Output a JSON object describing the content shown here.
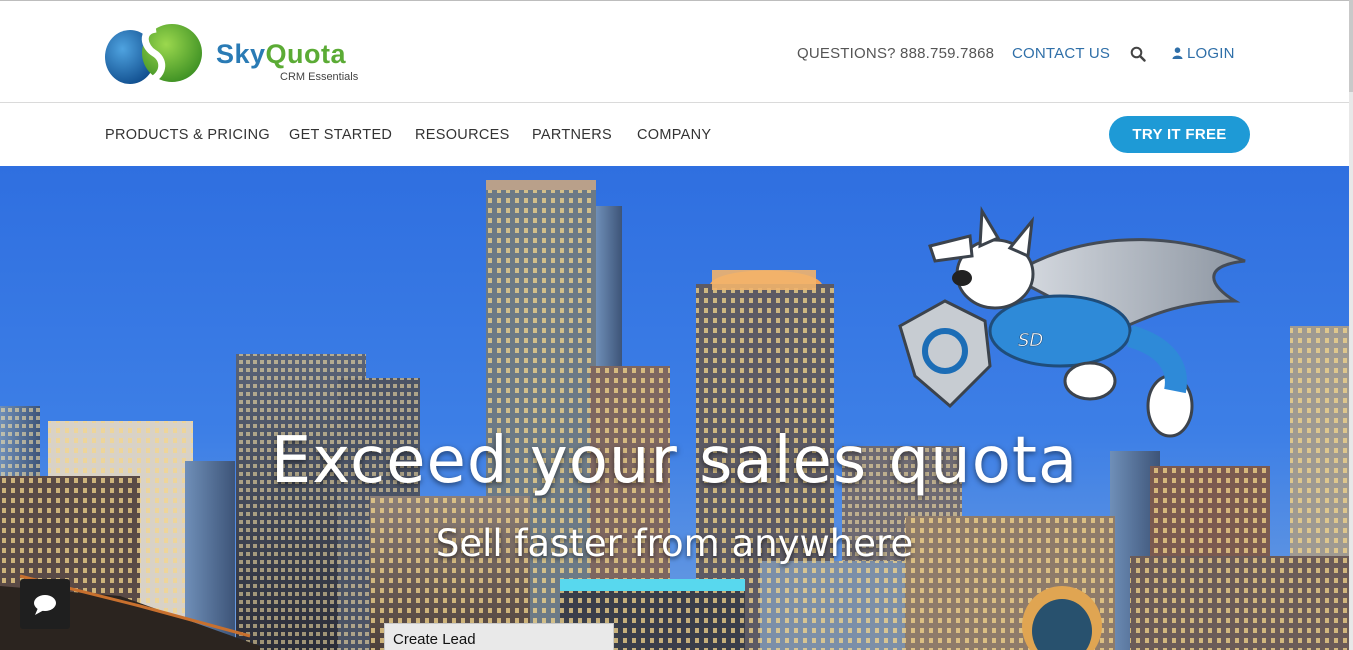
{
  "brand": {
    "name_part1": "Sky",
    "name_part2": "Quota",
    "tagline": "CRM Essentials",
    "colors": {
      "blue": "#2a7bb5",
      "green": "#5bab35"
    }
  },
  "header": {
    "questions": "QUESTIONS? 888.759.7868",
    "contact": "CONTACT US",
    "search_icon": "search-icon",
    "login": "LOGIN",
    "login_icon": "user-icon"
  },
  "nav": {
    "items": [
      {
        "label": "PRODUCTS & PRICING"
      },
      {
        "label": "GET STARTED"
      },
      {
        "label": "RESOURCES"
      },
      {
        "label": "PARTNERS"
      },
      {
        "label": "COMPANY"
      }
    ],
    "cta": "TRY IT FREE",
    "cta_color": "#1e9ad6"
  },
  "hero": {
    "title": "Exceed your sales quota",
    "subtitle": "Sell faster from anywhere",
    "mascot_badge": "SD"
  },
  "widgets": {
    "chat_icon": "chat-bubble-icon",
    "create_lead": "Create Lead"
  }
}
